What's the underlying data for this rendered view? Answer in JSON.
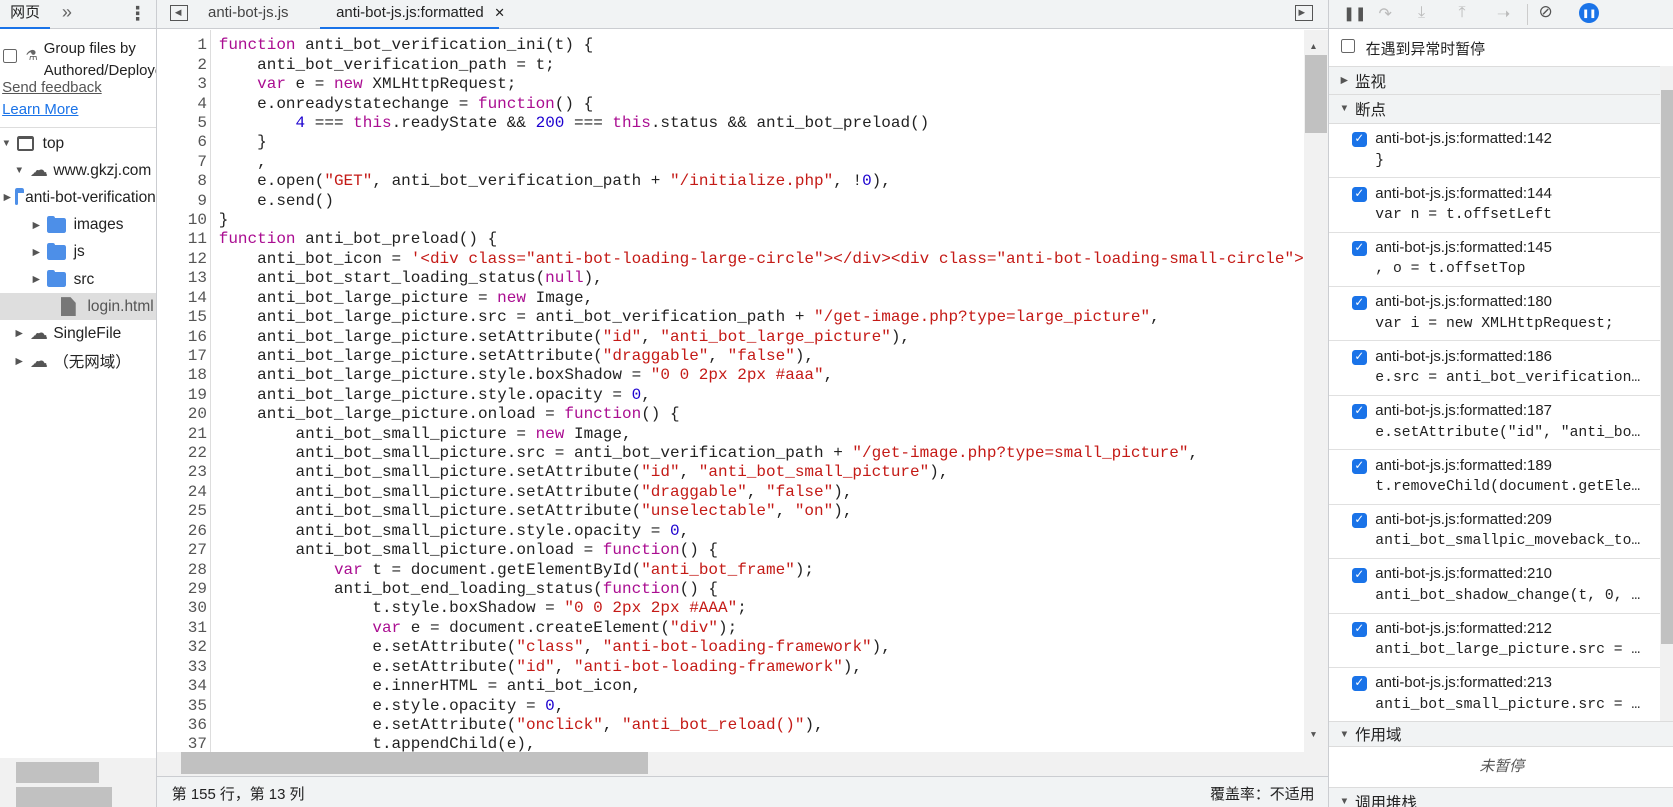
{
  "left": {
    "tab": "网页",
    "more": "»",
    "menu": "⋮",
    "group_label_1": "Group files by",
    "group_label_2": "Authored/Deployed",
    "send_feedback": "Send feedback",
    "learn_more": "Learn More",
    "tree": [
      {
        "label": "top",
        "type": "frame",
        "depth": 0,
        "open": true
      },
      {
        "label": "www.gkzj.com",
        "type": "cloud",
        "depth": 1,
        "open": true
      },
      {
        "label": "anti-bot-verification",
        "type": "folder",
        "depth": 2
      },
      {
        "label": "images",
        "type": "folder",
        "depth": 2
      },
      {
        "label": "js",
        "type": "folder",
        "depth": 2
      },
      {
        "label": "src",
        "type": "folder",
        "depth": 2
      },
      {
        "label": "login.html",
        "type": "file",
        "depth": 2,
        "selected": true
      },
      {
        "label": "SingleFile",
        "type": "cloud",
        "depth": 1
      },
      {
        "label": "（无网域）",
        "type": "cloud",
        "depth": 1
      }
    ]
  },
  "editor": {
    "tabs": [
      {
        "label": "anti-bot-js.js"
      },
      {
        "label": "anti-bot-js.js:formatted",
        "active": true,
        "close": "✕"
      }
    ],
    "status_position": "第 155 行，第 13 列",
    "status_coverage": "覆盖率：不适用",
    "lines": [
      [
        [
          "k",
          "function"
        ],
        [
          "p",
          " anti_bot_verification_ini(t) {"
        ]
      ],
      [
        [
          "p",
          "    anti_bot_verification_path = t;"
        ]
      ],
      [
        [
          "p",
          "    "
        ],
        [
          "k",
          "var"
        ],
        [
          "p",
          " e = "
        ],
        [
          "k",
          "new"
        ],
        [
          "p",
          " XMLHttpRequest;"
        ]
      ],
      [
        [
          "p",
          "    e.onreadystatechange = "
        ],
        [
          "k",
          "function"
        ],
        [
          "p",
          "() {"
        ]
      ],
      [
        [
          "p",
          "        "
        ],
        [
          "n",
          "4"
        ],
        [
          "p",
          " === "
        ],
        [
          "k",
          "this"
        ],
        [
          "p",
          ".readyState && "
        ],
        [
          "n",
          "200"
        ],
        [
          "p",
          " === "
        ],
        [
          "k",
          "this"
        ],
        [
          "p",
          ".status && anti_bot_preload()"
        ]
      ],
      [
        [
          "p",
          "    }"
        ]
      ],
      [
        [
          "p",
          "    ,"
        ]
      ],
      [
        [
          "p",
          "    e.open("
        ],
        [
          "s",
          "\"GET\""
        ],
        [
          "p",
          ", anti_bot_verification_path + "
        ],
        [
          "s",
          "\"/initialize.php\""
        ],
        [
          "p",
          ", !"
        ],
        [
          "n",
          "0"
        ],
        [
          "p",
          "),"
        ]
      ],
      [
        [
          "p",
          "    e.send()"
        ]
      ],
      [
        [
          "p",
          "}"
        ]
      ],
      [
        [
          "k",
          "function"
        ],
        [
          "p",
          " anti_bot_preload() {"
        ]
      ],
      [
        [
          "p",
          "    anti_bot_icon = "
        ],
        [
          "s",
          "'<div class=\"anti-bot-loading-large-circle\"></div><div class=\"anti-bot-loading-small-circle\"></div><di"
        ]
      ],
      [
        [
          "p",
          "    anti_bot_start_loading_status("
        ],
        [
          "k",
          "null"
        ],
        [
          "p",
          "),"
        ]
      ],
      [
        [
          "p",
          "    anti_bot_large_picture = "
        ],
        [
          "k",
          "new"
        ],
        [
          "p",
          " Image,"
        ]
      ],
      [
        [
          "p",
          "    anti_bot_large_picture.src = anti_bot_verification_path + "
        ],
        [
          "s",
          "\"/get-image.php?type=large_picture\""
        ],
        [
          "p",
          ","
        ]
      ],
      [
        [
          "p",
          "    anti_bot_large_picture.setAttribute("
        ],
        [
          "s",
          "\"id\""
        ],
        [
          "p",
          ", "
        ],
        [
          "s",
          "\"anti_bot_large_picture\""
        ],
        [
          "p",
          "),"
        ]
      ],
      [
        [
          "p",
          "    anti_bot_large_picture.setAttribute("
        ],
        [
          "s",
          "\"draggable\""
        ],
        [
          "p",
          ", "
        ],
        [
          "s",
          "\"false\""
        ],
        [
          "p",
          "),"
        ]
      ],
      [
        [
          "p",
          "    anti_bot_large_picture.style.boxShadow = "
        ],
        [
          "s",
          "\"0 0 2px 2px #aaa\""
        ],
        [
          "p",
          ","
        ]
      ],
      [
        [
          "p",
          "    anti_bot_large_picture.style.opacity = "
        ],
        [
          "n",
          "0"
        ],
        [
          "p",
          ","
        ]
      ],
      [
        [
          "p",
          "    anti_bot_large_picture.onload = "
        ],
        [
          "k",
          "function"
        ],
        [
          "p",
          "() {"
        ]
      ],
      [
        [
          "p",
          "        anti_bot_small_picture = "
        ],
        [
          "k",
          "new"
        ],
        [
          "p",
          " Image,"
        ]
      ],
      [
        [
          "p",
          "        anti_bot_small_picture.src = anti_bot_verification_path + "
        ],
        [
          "s",
          "\"/get-image.php?type=small_picture\""
        ],
        [
          "p",
          ","
        ]
      ],
      [
        [
          "p",
          "        anti_bot_small_picture.setAttribute("
        ],
        [
          "s",
          "\"id\""
        ],
        [
          "p",
          ", "
        ],
        [
          "s",
          "\"anti_bot_small_picture\""
        ],
        [
          "p",
          "),"
        ]
      ],
      [
        [
          "p",
          "        anti_bot_small_picture.setAttribute("
        ],
        [
          "s",
          "\"draggable\""
        ],
        [
          "p",
          ", "
        ],
        [
          "s",
          "\"false\""
        ],
        [
          "p",
          "),"
        ]
      ],
      [
        [
          "p",
          "        anti_bot_small_picture.setAttribute("
        ],
        [
          "s",
          "\"unselectable\""
        ],
        [
          "p",
          ", "
        ],
        [
          "s",
          "\"on\""
        ],
        [
          "p",
          "),"
        ]
      ],
      [
        [
          "p",
          "        anti_bot_small_picture.style.opacity = "
        ],
        [
          "n",
          "0"
        ],
        [
          "p",
          ","
        ]
      ],
      [
        [
          "p",
          "        anti_bot_small_picture.onload = "
        ],
        [
          "k",
          "function"
        ],
        [
          "p",
          "() {"
        ]
      ],
      [
        [
          "p",
          "            "
        ],
        [
          "k",
          "var"
        ],
        [
          "p",
          " t = document.getElementById("
        ],
        [
          "s",
          "\"anti_bot_frame\""
        ],
        [
          "p",
          ");"
        ]
      ],
      [
        [
          "p",
          "            anti_bot_end_loading_status("
        ],
        [
          "k",
          "function"
        ],
        [
          "p",
          "() {"
        ]
      ],
      [
        [
          "p",
          "                t.style.boxShadow = "
        ],
        [
          "s",
          "\"0 0 2px 2px #AAA\""
        ],
        [
          "p",
          ";"
        ]
      ],
      [
        [
          "p",
          "                "
        ],
        [
          "k",
          "var"
        ],
        [
          "p",
          " e = document.createElement("
        ],
        [
          "s",
          "\"div\""
        ],
        [
          "p",
          ");"
        ]
      ],
      [
        [
          "p",
          "                e.setAttribute("
        ],
        [
          "s",
          "\"class\""
        ],
        [
          "p",
          ", "
        ],
        [
          "s",
          "\"anti-bot-loading-framework\""
        ],
        [
          "p",
          "),"
        ]
      ],
      [
        [
          "p",
          "                e.setAttribute("
        ],
        [
          "s",
          "\"id\""
        ],
        [
          "p",
          ", "
        ],
        [
          "s",
          "\"anti-bot-loading-framework\""
        ],
        [
          "p",
          "),"
        ]
      ],
      [
        [
          "p",
          "                e.innerHTML = anti_bot_icon,"
        ]
      ],
      [
        [
          "p",
          "                e.style.opacity = "
        ],
        [
          "n",
          "0"
        ],
        [
          "p",
          ","
        ]
      ],
      [
        [
          "p",
          "                e.setAttribute("
        ],
        [
          "s",
          "\"onclick\""
        ],
        [
          "p",
          ", "
        ],
        [
          "s",
          "\"anti_bot_reload()\""
        ],
        [
          "p",
          "),"
        ]
      ],
      [
        [
          "p",
          "                t.appendChild(e),"
        ]
      ]
    ]
  },
  "debugger": {
    "pause_on_exceptions": "在遇到异常时暂停",
    "watch": "监视",
    "breakpoints_title": "断点",
    "scope": "作用域",
    "not_paused": "未暂停",
    "call_stack": "调用堆栈",
    "breakpoints": [
      {
        "location": "anti-bot-js.js:formatted:142",
        "code": "}"
      },
      {
        "location": "anti-bot-js.js:formatted:144",
        "code": "var n = t.offsetLeft"
      },
      {
        "location": "anti-bot-js.js:formatted:145",
        "code": ", o = t.offsetTop"
      },
      {
        "location": "anti-bot-js.js:formatted:180",
        "code": "var i = new XMLHttpRequest;"
      },
      {
        "location": "anti-bot-js.js:formatted:186",
        "code": "e.src = anti_bot_verification…"
      },
      {
        "location": "anti-bot-js.js:formatted:187",
        "code": "e.setAttribute(\"id\", \"anti_bo…"
      },
      {
        "location": "anti-bot-js.js:formatted:189",
        "code": "t.removeChild(document.getEle…"
      },
      {
        "location": "anti-bot-js.js:formatted:209",
        "code": "anti_bot_smallpic_moveback_to…"
      },
      {
        "location": "anti-bot-js.js:formatted:210",
        "code": "anti_bot_shadow_change(t, 0, …"
      },
      {
        "location": "anti-bot-js.js:formatted:212",
        "code": "anti_bot_large_picture.src = …"
      },
      {
        "location": "anti-bot-js.js:formatted:213",
        "code": "anti_bot_small_picture.src = …"
      }
    ]
  },
  "colors": {
    "accent": "#1a73e8",
    "keyword": "#aa0d91",
    "string": "#c41a16",
    "number": "#1c00cf"
  }
}
